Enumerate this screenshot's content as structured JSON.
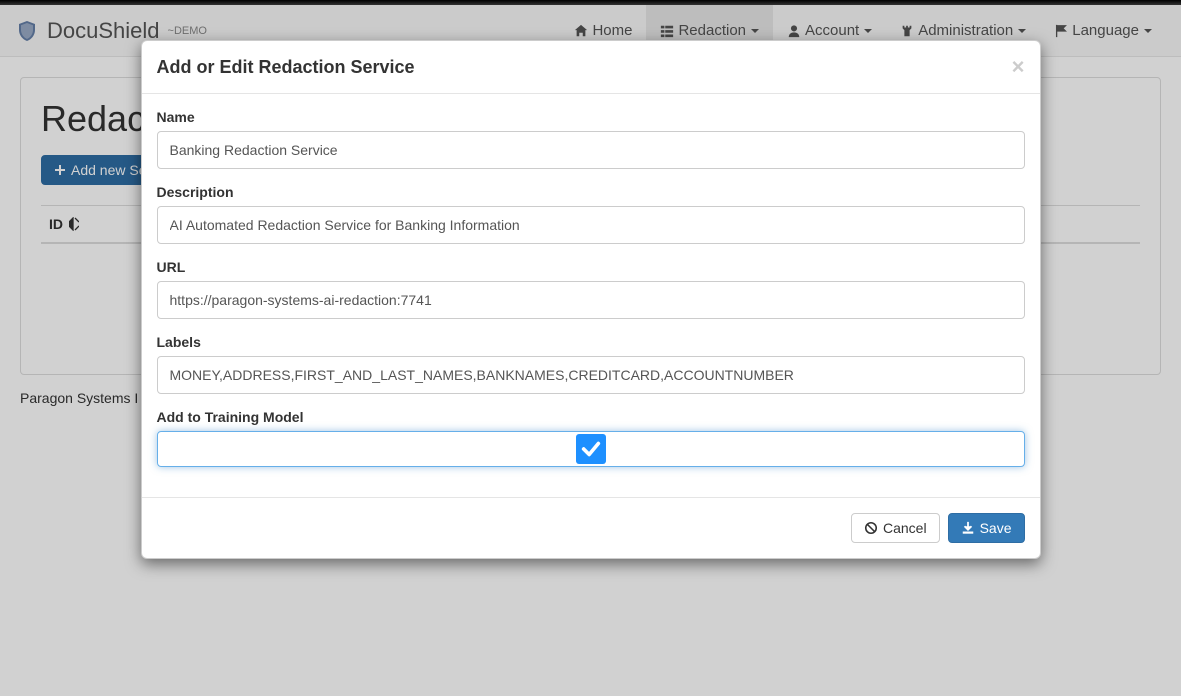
{
  "brand": {
    "name": "DocuShield",
    "suffix": "~DEMO"
  },
  "nav": {
    "home": "Home",
    "redaction": "Redaction",
    "account": "Account",
    "administration": "Administration",
    "language": "Language"
  },
  "page": {
    "title_partial": "Redacti",
    "add_button": "Add new Se",
    "table_id_col": "ID",
    "footer": "Paragon Systems I"
  },
  "modal": {
    "title": "Add or Edit Redaction Service",
    "labels": {
      "name": "Name",
      "description": "Description",
      "url": "URL",
      "labels_field": "Labels",
      "training": "Add to Training Model"
    },
    "values": {
      "name": "Banking Redaction Service",
      "description": "AI Automated Redaction Service for Banking Information",
      "url": "https://paragon-systems-ai-redaction:7741",
      "labels_field": "MONEY,ADDRESS,FIRST_AND_LAST_NAMES,BANKNAMES,CREDITCARD,ACCOUNTNUMBER",
      "training_checked": true
    },
    "buttons": {
      "cancel": "Cancel",
      "save": "Save"
    }
  }
}
